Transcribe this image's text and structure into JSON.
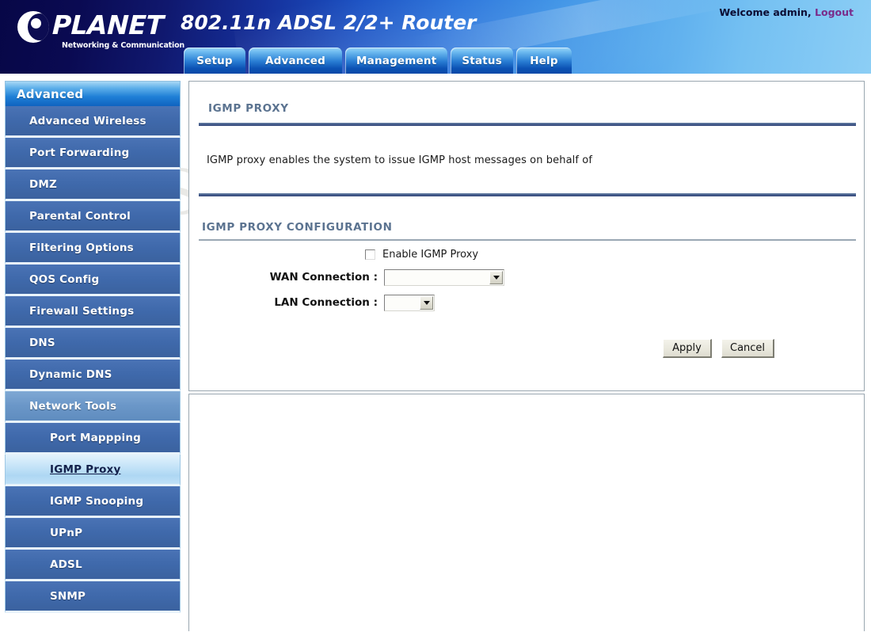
{
  "header": {
    "brand_name": "PLANET",
    "brand_tagline": "Networking & Communication",
    "model_title": "802.11n ADSL 2/2+ Router",
    "welcome_text": "Welcome admin,",
    "logout_label": "Logout"
  },
  "tabs": [
    {
      "label": "Setup",
      "active": false
    },
    {
      "label": "Advanced",
      "active": true
    },
    {
      "label": "Management",
      "active": false
    },
    {
      "label": "Status",
      "active": false
    },
    {
      "label": "Help",
      "active": false
    }
  ],
  "sidebar": {
    "heading": "Advanced",
    "items": [
      {
        "label": "Advanced Wireless",
        "level": 1,
        "state": "normal"
      },
      {
        "label": "Port Forwarding",
        "level": 1,
        "state": "normal"
      },
      {
        "label": "DMZ",
        "level": 1,
        "state": "normal"
      },
      {
        "label": "Parental Control",
        "level": 1,
        "state": "normal"
      },
      {
        "label": "Filtering Options",
        "level": 1,
        "state": "normal"
      },
      {
        "label": "QOS Config",
        "level": 1,
        "state": "normal"
      },
      {
        "label": "Firewall Settings",
        "level": 1,
        "state": "normal"
      },
      {
        "label": "DNS",
        "level": 1,
        "state": "normal"
      },
      {
        "label": "Dynamic DNS",
        "level": 1,
        "state": "normal"
      },
      {
        "label": "Network Tools",
        "level": 1,
        "state": "parent-open"
      },
      {
        "label": "Port Mappping",
        "level": 2,
        "state": "normal"
      },
      {
        "label": "IGMP Proxy",
        "level": 2,
        "state": "active"
      },
      {
        "label": "IGMP Snooping",
        "level": 2,
        "state": "normal"
      },
      {
        "label": "UPnP",
        "level": 2,
        "state": "normal"
      },
      {
        "label": "ADSL",
        "level": 2,
        "state": "normal"
      },
      {
        "label": "SNMP",
        "level": 2,
        "state": "normal"
      }
    ]
  },
  "main": {
    "page_title": "IGMP PROXY",
    "description": "IGMP proxy enables the system to issue IGMP host messages on behalf of",
    "config_title": "IGMP PROXY CONFIGURATION",
    "enable_checkbox_label": "Enable IGMP Proxy",
    "enable_checkbox_checked": false,
    "wan_label": "WAN Connection :",
    "wan_value": "",
    "lan_label": "LAN Connection :",
    "lan_value": "",
    "apply_label": "Apply",
    "cancel_label": "Cancel"
  },
  "watermark": {
    "text": "SetupRouter.com"
  },
  "colors": {
    "header_dark": "#070747",
    "header_light": "#8ccef5",
    "nav_item_bg": "#3f69ab",
    "nav_active_bg": "#c6e4f8",
    "section_title": "#5b7390",
    "rule": "#42588a",
    "logout_link": "#7a2b8a"
  }
}
